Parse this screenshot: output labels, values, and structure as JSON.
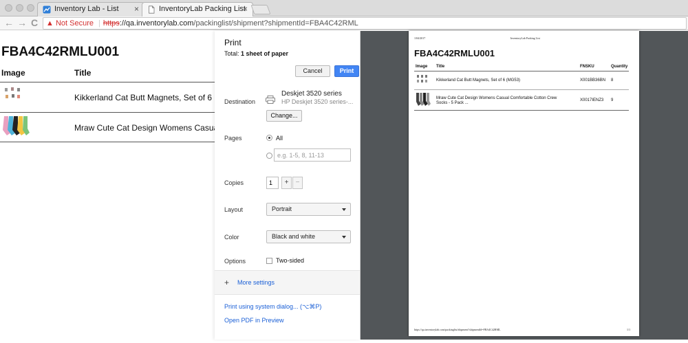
{
  "browser": {
    "tabs": [
      {
        "title": "Inventory Lab - List",
        "active": false
      },
      {
        "title": "InventoryLab Packing List",
        "active": true
      }
    ],
    "nav": {
      "back": "←",
      "forward": "→",
      "reload": "C"
    },
    "address": {
      "security_label": "Not Secure",
      "scheme": "https",
      "host": "://qa.inventorylab.com",
      "path": "/packinglist/shipment?shipmentId=FBA4C42RML"
    }
  },
  "page": {
    "heading": "FBA4C42RMLU001",
    "columns": {
      "image": "Image",
      "title": "Title"
    },
    "rows": [
      {
        "title": "Kikkerland Cat Butt Magnets, Set of 6 (MG"
      },
      {
        "title": "Mraw Cute Cat Design Womens Casual Co"
      }
    ]
  },
  "print_dialog": {
    "title": "Print",
    "total_prefix": "Total: ",
    "total_value": "1 sheet of paper",
    "cancel_label": "Cancel",
    "print_label": "Print",
    "destination": {
      "label": "Destination",
      "printer_name": "Deskjet 3520 series",
      "printer_model": "HP Deskjet 3520 series-...",
      "change_label": "Change..."
    },
    "pages": {
      "label": "Pages",
      "all_label": "All",
      "all_selected": true,
      "custom_placeholder": "e.g. 1-5, 8, 11-13"
    },
    "copies": {
      "label": "Copies",
      "value": "1",
      "plus": "+",
      "minus": "−"
    },
    "layout": {
      "label": "Layout",
      "value": "Portrait"
    },
    "color": {
      "label": "Color",
      "value": "Black and white"
    },
    "options": {
      "label": "Options",
      "two_sided_label": "Two-sided",
      "two_sided_checked": false
    },
    "more_settings": {
      "icon": "+",
      "label": "More settings"
    },
    "system_dialog_label": "Print using system dialog... (⌥⌘P)",
    "open_pdf_label": "Open PDF in Preview"
  },
  "preview": {
    "date": "1/04/2017",
    "header_title": "InventoryLab Packing List",
    "heading": "FBA4C42RMLU001",
    "columns": {
      "image": "Image",
      "title": "Title",
      "fnsku": "FNSKU",
      "quantity": "Quantity"
    },
    "rows": [
      {
        "title_line1": "Kikkerland Cat Butt Magnets, Set of 6 (MG53)",
        "title_line2": "",
        "fnsku": "X001BB36BN",
        "quantity": "8"
      },
      {
        "title_line1": "Mraw Cute Cat Design Womens Casual Comfortable Cotton Crew",
        "title_line2": "Socks - 5 Pack ...",
        "fnsku": "X0017IENZ3",
        "quantity": "9"
      }
    ],
    "footer_url": "https://qa.inventorylab.com/packinglist/shipment?shipmentId=FBA4C42RML",
    "footer_page": "1/1"
  },
  "colors": {
    "accent_blue": "#4285f4",
    "link_blue": "#1a5fd6",
    "warning_red": "#d32f2f",
    "preview_background": "#525659"
  }
}
